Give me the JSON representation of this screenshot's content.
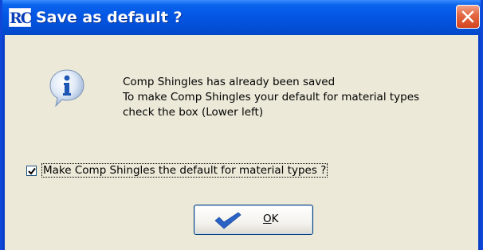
{
  "window": {
    "title": "Save as default ?",
    "app_icon_text": "RC",
    "close_icon": "close-icon"
  },
  "message": {
    "icon": "info-icon",
    "lines": [
      "Comp Shingles has already been saved",
      "To make Comp Shingles your default for material types",
      "check the box (Lower left)"
    ]
  },
  "checkbox": {
    "label": "Make Comp Shingles the default for material types ?",
    "checked": true
  },
  "ok_button": {
    "mnemonic": "O",
    "label_rest": "K",
    "icon": "checkmark-icon"
  },
  "colors": {
    "titlebar": "#0456e4",
    "close": "#d2441f",
    "face": "#ece9d8",
    "checkmark": "#2a62c6"
  }
}
